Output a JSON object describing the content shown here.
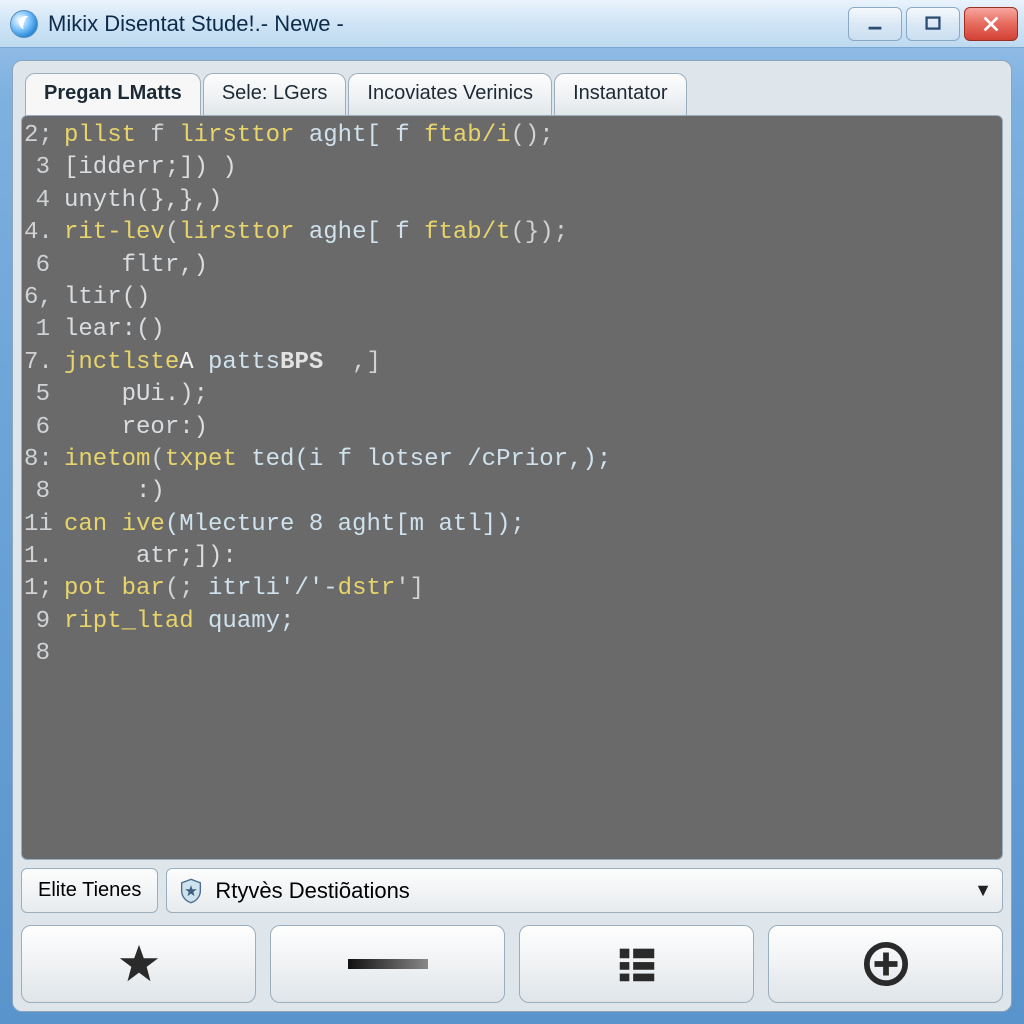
{
  "window": {
    "title": "Mikix Disentat Stude!.- Newe -"
  },
  "tabs": [
    {
      "label": "Pregan LMatts",
      "active": true
    },
    {
      "label": "Sele: LGers",
      "active": false
    },
    {
      "label": "Incoviates Verinics",
      "active": false
    },
    {
      "label": "Instantator",
      "active": false
    }
  ],
  "code": {
    "gutter": [
      "2;",
      "3",
      "4",
      "4.",
      "6",
      "6,",
      "1",
      "7.",
      "5",
      "6",
      "8:",
      "8",
      "1i",
      "1.",
      "1;",
      "9",
      "8"
    ],
    "lines": [
      [
        {
          "t": "pllst",
          "c": "kw"
        },
        {
          "t": " f ",
          "c": "op"
        },
        {
          "t": "lirsttor",
          "c": "fn"
        },
        {
          "t": " aght[ f ",
          "c": "id"
        },
        {
          "t": "ftab/i",
          "c": "kw"
        },
        {
          "t": "();",
          "c": "op"
        }
      ],
      [
        {
          "t": "[idderr;]) )",
          "c": "mut"
        }
      ],
      [
        {
          "t": "unyth(},},)",
          "c": "mut"
        }
      ],
      [
        {
          "t": "rit-lev",
          "c": "kw"
        },
        {
          "t": "(",
          "c": "op"
        },
        {
          "t": "lirsttor",
          "c": "fn"
        },
        {
          "t": " aghe[ f ",
          "c": "id"
        },
        {
          "t": "ftab/t",
          "c": "kw"
        },
        {
          "t": "(});",
          "c": "op"
        }
      ],
      [
        {
          "t": "    fltr,)",
          "c": "mut"
        }
      ],
      [
        {
          "t": "ltir()",
          "c": "mut"
        }
      ],
      [
        {
          "t": "lear:()",
          "c": "mut"
        }
      ],
      [
        {
          "t": "jnctlste",
          "c": "kw"
        },
        {
          "t": "A",
          "c": "hi"
        },
        {
          "t": " patts",
          "c": "id"
        },
        {
          "t": "BPS",
          "c": "type"
        },
        {
          "t": "  ,]",
          "c": "op"
        }
      ],
      [
        {
          "t": "    pUi.);",
          "c": "mut"
        }
      ],
      [
        {
          "t": "    reor:)",
          "c": "mut"
        }
      ],
      [
        {
          "t": "inetom",
          "c": "kw"
        },
        {
          "t": "(",
          "c": "op"
        },
        {
          "t": "txpet",
          "c": "fn"
        },
        {
          "t": " ted(i f lotser /cPrior,);",
          "c": "id"
        }
      ],
      [
        {
          "t": "     :)",
          "c": "mut"
        }
      ],
      [
        {
          "t": "can ",
          "c": "kw"
        },
        {
          "t": "ive",
          "c": "fn"
        },
        {
          "t": "(Mlecture 8 aght[m atl]);",
          "c": "id"
        }
      ],
      [
        {
          "t": "     atr;]):",
          "c": "mut"
        }
      ],
      [
        {
          "t": "pot ",
          "c": "kw"
        },
        {
          "t": "bar",
          "c": "fn"
        },
        {
          "t": "(; ",
          "c": "op"
        },
        {
          "t": "itrli'/'-",
          "c": "id"
        },
        {
          "t": "dstr",
          "c": "kw"
        },
        {
          "t": "']",
          "c": "op"
        }
      ],
      [
        {
          "t": "ript_ltad",
          "c": "kw"
        },
        {
          "t": " quamy;",
          "c": "id"
        }
      ],
      [
        {
          "t": "",
          "c": "mut"
        }
      ]
    ]
  },
  "filter": {
    "label": "Elite Tienes",
    "dropdown_value": "Rtyvès Destiõations"
  },
  "toolbar_icons": [
    "star-icon",
    "line-icon",
    "bars-icon",
    "plus-icon"
  ]
}
